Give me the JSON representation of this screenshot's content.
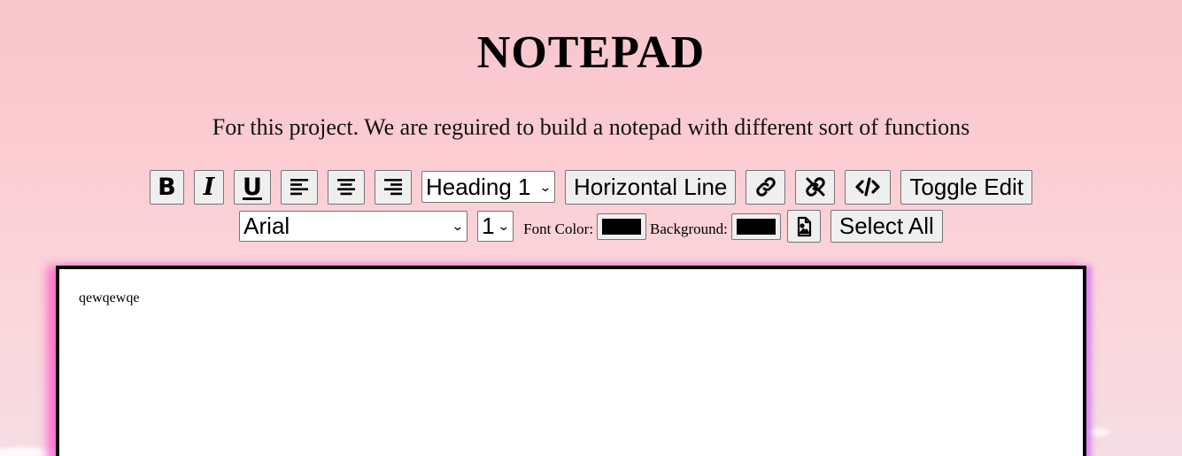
{
  "page": {
    "title": "NOTEPAD",
    "subtitle": "For this project. We are reguired to build a notepad with different sort of functions"
  },
  "toolbar": {
    "bold": {
      "icon": "bold-icon",
      "label": "B"
    },
    "italic": {
      "icon": "italic-icon",
      "label": "I"
    },
    "underline": {
      "icon": "underline-icon",
      "label": "U"
    },
    "align_left": {
      "icon": "align-left-icon"
    },
    "align_center": {
      "icon": "align-center-icon"
    },
    "align_right": {
      "icon": "align-right-icon"
    },
    "heading_select": {
      "value": "Heading 1"
    },
    "horizontal_line_label": "Horizontal Line",
    "link": {
      "icon": "link-icon"
    },
    "unlink": {
      "icon": "unlink-icon"
    },
    "code": {
      "icon": "code-icon"
    },
    "toggle_edit_label": "Toggle Edit",
    "font_select": {
      "value": "Arial"
    },
    "size_select": {
      "value": "1"
    },
    "font_color_label": "Font Color:",
    "font_color_value": "#000000",
    "background_label": "Background:",
    "background_value": "#000000",
    "insert_image": {
      "icon": "image-file-icon"
    },
    "select_all_label": "Select All"
  },
  "editor": {
    "content": "qewqewqe"
  },
  "colors": {
    "background_top": "#f8c6cc",
    "editor_border": "#000000",
    "editor_glow": "#ff50c8"
  }
}
